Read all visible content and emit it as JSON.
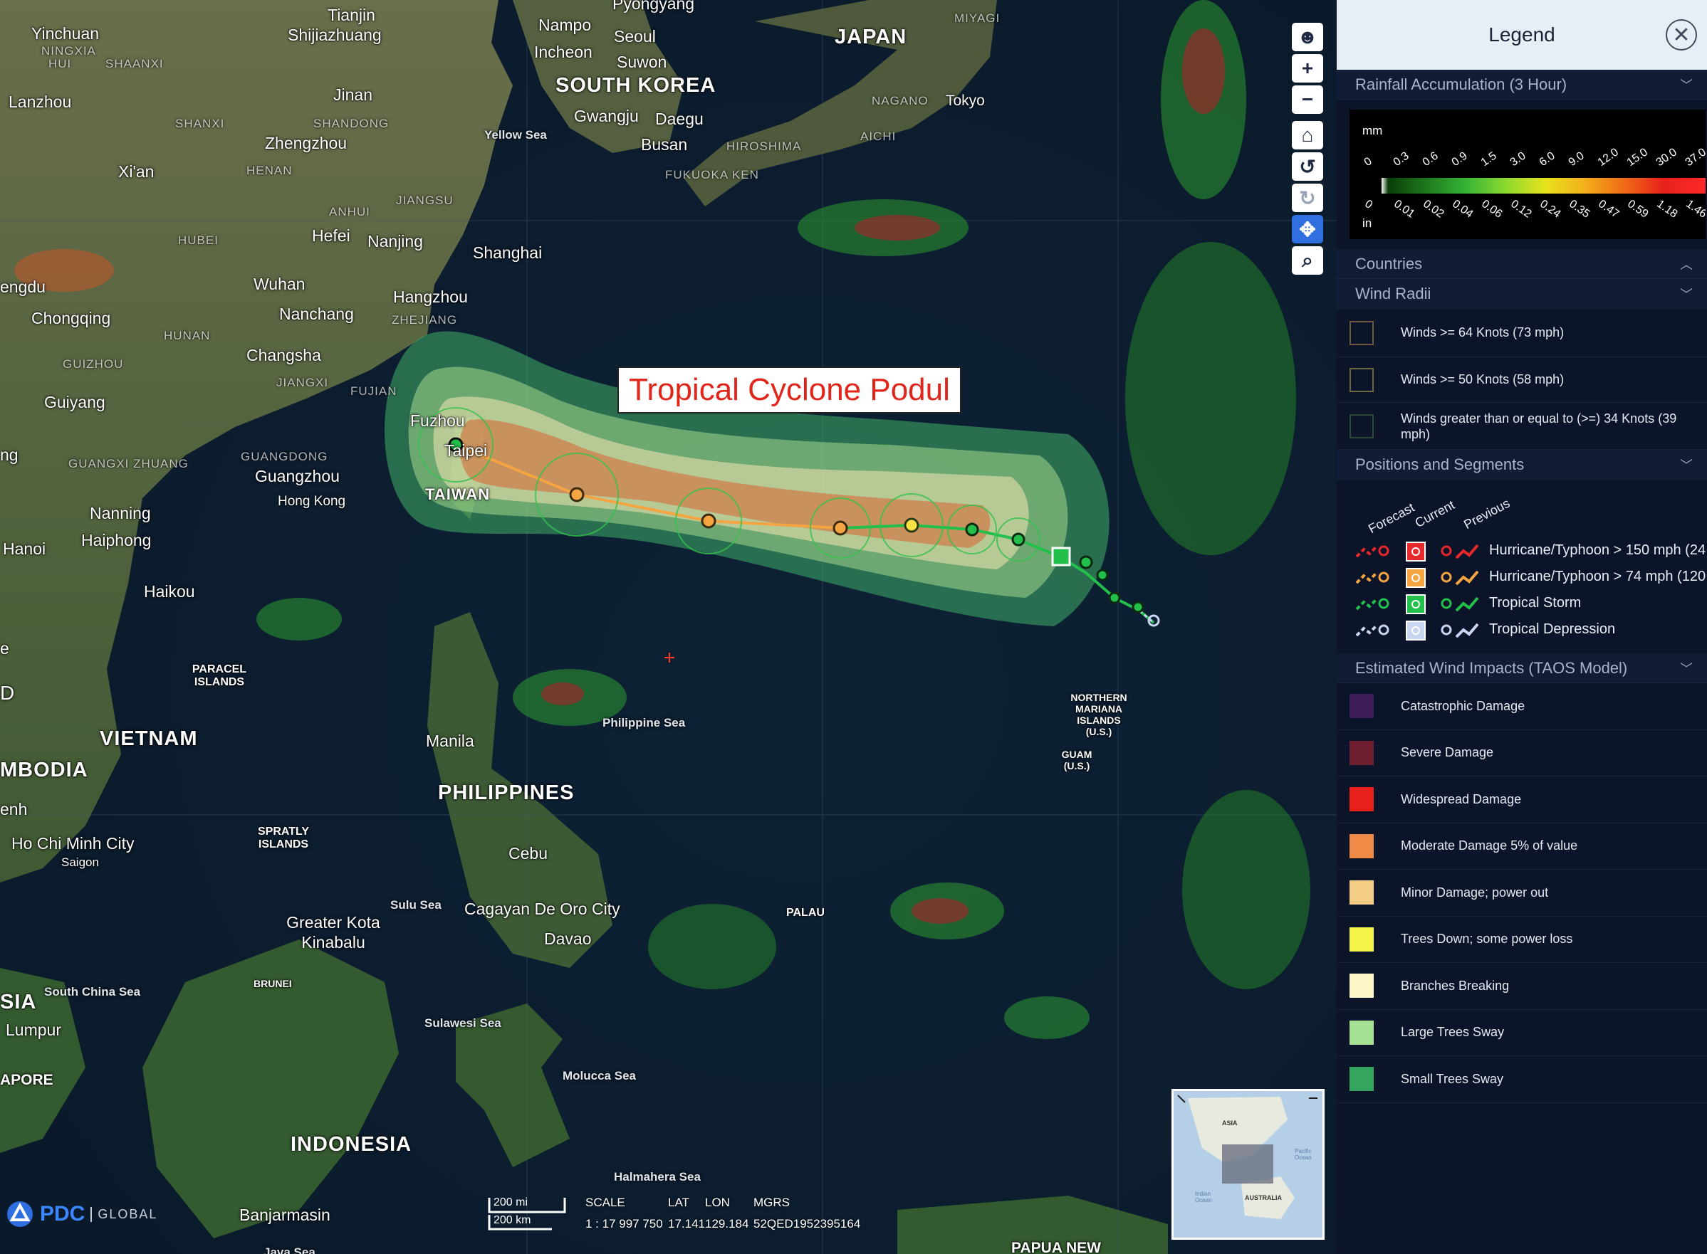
{
  "map": {
    "storm_title": "Tropical Cyclone Podul",
    "labels": {
      "countries": [
        "JAPAN",
        "SOUTH KOREA",
        "VIETNAM",
        "PHILIPPINES",
        "INDONESIA",
        "TAIWAN",
        "MBODIA",
        "SIA"
      ],
      "cities": [
        "Yinchuan",
        "Tianjin",
        "Shijiazhuang",
        "Nampo",
        "Incheon",
        "Seoul",
        "Suwon",
        "Pyongyang",
        "Lanzhou",
        "Jinan",
        "Zhengzhou",
        "Xi'an",
        "Gwangju",
        "Daegu",
        "Busan",
        "Tokyo",
        "Hefei",
        "Nanjing",
        "Shanghai",
        "Wuhan",
        "Hangzhou",
        "Nanchang",
        "Chongqing",
        "Changsha",
        "Guiyang",
        "Fuzhou",
        "Taipei",
        "Guangzhou",
        "Hong Kong",
        "Nanning",
        "Haiphong",
        "Hanoi",
        "Haikou",
        "Manila",
        "Cebu",
        "Cagayan De Oro City",
        "Davao",
        "Ho Chi Minh City",
        "Saigon",
        "Greater Kota Kinabalu",
        "Lumpur",
        "Banjarmasin",
        "engdu",
        "ng",
        "enh"
      ],
      "regions": [
        "NINGXIA",
        "HUI",
        "SHAANXI",
        "SHANXI",
        "SHANDONG",
        "HENAN",
        "ANHUI",
        "JIANGSU",
        "HUBEI",
        "ZHEJIANG",
        "HUNAN",
        "JIANGXI",
        "FUJIAN",
        "GUIZHOU",
        "GUANGDONG",
        "GUANGXI ZHUANG",
        "NAGANO",
        "AICHI",
        "HIROSHIMA",
        "FUKUOKA KEN",
        "MIYAGI"
      ],
      "seas": [
        "Yellow Sea",
        "Philippine Sea",
        "Sulu Sea",
        "South China Sea",
        "Sulawesi Sea",
        "Molucca Sea",
        "Halmahera Sea"
      ],
      "islands": [
        "PARACEL ISLANDS",
        "SPRATLY ISLANDS",
        "NORTHERN MARIANA ISLANDS (U.S.)",
        "GUAM (U.S.)",
        "PALAU",
        "BRUNEI",
        "APORE",
        "PAPUA NEW"
      ],
      "misc": [
        "D",
        "e",
        "Java Sea"
      ]
    },
    "toolbar": [
      {
        "icon": "person-icon",
        "label": "☻"
      },
      {
        "icon": "zoom-in-icon",
        "label": "+"
      },
      {
        "icon": "zoom-out-icon",
        "label": "−"
      },
      {
        "icon": "home-icon",
        "label": "⌂"
      },
      {
        "icon": "rotate-left-icon",
        "label": "↺"
      },
      {
        "icon": "rotate-right-icon",
        "label": "↻"
      },
      {
        "icon": "pan-icon",
        "label": "✥"
      },
      {
        "icon": "zoom-box-icon",
        "label": "⌕"
      }
    ],
    "status": {
      "scale_mi": "200 mi",
      "scale_km": "200 km",
      "scale_label": "SCALE",
      "scale_value": "1 : 17 997 750",
      "lat_label": "LAT",
      "lat_value": "17.141",
      "lon_label": "LON",
      "lon_value": "129.184",
      "mgrs_label": "MGRS",
      "mgrs_value": "52QED1952395164"
    },
    "brand": {
      "name": "PDC",
      "suffix": "GLOBAL"
    },
    "overview": {
      "label_asia": "ASIA",
      "label_australia": "AUSTRALIA",
      "label_pacific": "Pacific Ocean",
      "label_indian": "Indian Ocean"
    }
  },
  "legend": {
    "title": "Legend",
    "sections": {
      "rainfall": "Rainfall Accumulation (3 Hour)",
      "countries": "Countries",
      "wind_radii": "Wind Radii",
      "positions": "Positions and Segments",
      "taos": "Estimated Wind Impacts (TAOS Model)"
    },
    "rainfall": {
      "unit_mm": "mm",
      "unit_in": "in",
      "mm_ticks": [
        "0",
        "0.3",
        "0.6",
        "0.9",
        "1.5",
        "3.0",
        "6.0",
        "9.0",
        "12.0",
        "15.0",
        "30.0",
        "37.0"
      ],
      "in_ticks": [
        "0",
        "0.01",
        "0.02",
        "0.04",
        "0.06",
        "0.12",
        "0.24",
        "0.35",
        "0.47",
        "0.59",
        "1.18",
        "1.46"
      ]
    },
    "wind_radii": [
      {
        "label": "Winds >= 64 Knots (73 mph)"
      },
      {
        "label": "Winds >= 50 Knots (58 mph)"
      },
      {
        "label": "Winds greater than or equal to (>=) 34 Knots (39 mph)"
      }
    ],
    "positions": {
      "col_headers": [
        "Forecast",
        "Current",
        "Previous"
      ],
      "rows": [
        {
          "label": "Hurricane/Typhoon > 150 mph (24",
          "color": "#e8282b"
        },
        {
          "label": "Hurricane/Typhoon > 74 mph (120",
          "color": "#f5a442"
        },
        {
          "label": "Tropical Storm",
          "color": "#22c04a"
        },
        {
          "label": "Tropical Depression",
          "color": "#c9d6f2"
        }
      ]
    },
    "taos": [
      {
        "label": "Catastrophic Damage",
        "color": "#3c1d58"
      },
      {
        "label": "Severe Damage",
        "color": "#6e2030"
      },
      {
        "label": "Widespread Damage",
        "color": "#e8201c"
      },
      {
        "label": "Moderate Damage 5% of value",
        "color": "#f08a47"
      },
      {
        "label": "Minor Damage; power out",
        "color": "#f6cd84"
      },
      {
        "label": "Trees Down; some power loss",
        "color": "#f6f34a"
      },
      {
        "label": "Branches Breaking",
        "color": "#fbf7c9"
      },
      {
        "label": "Large Trees Sway",
        "color": "#a6e092"
      },
      {
        "label": "Small Trees Sway",
        "color": "#33a55d"
      }
    ]
  }
}
